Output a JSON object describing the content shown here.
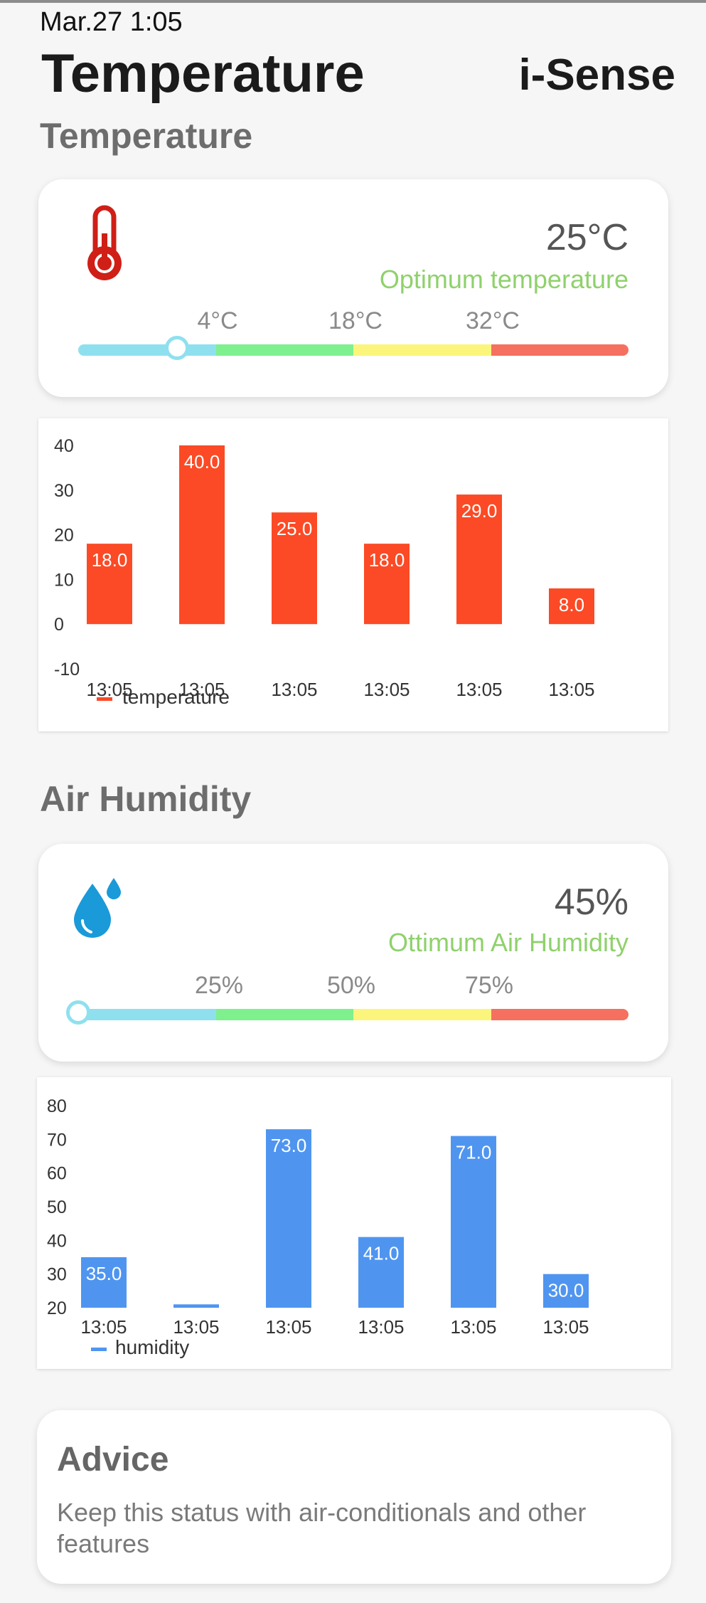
{
  "status_bar": {
    "time": "Mar.27 1:05"
  },
  "header": {
    "title": "Temperature",
    "brand": "i-Sense"
  },
  "temperature": {
    "section_title": "Temperature",
    "icon": "thermometer-icon",
    "value": "25°C",
    "status": "Optimum temperature",
    "scale_labels": [
      "4°C",
      "18°C",
      "32°C"
    ],
    "scale_colors": [
      "#8fe0ef",
      "#7ff08e",
      "#fbf57c",
      "#f5705e"
    ],
    "slider_fraction": 0.18
  },
  "temperature_chart": {
    "chart_data": {
      "type": "bar",
      "categories": [
        "13:05",
        "13:05",
        "13:05",
        "13:05",
        "13:05",
        "13:05"
      ],
      "series": [
        {
          "name": "temperature",
          "values": [
            18.0,
            40.0,
            25.0,
            18.0,
            29.0,
            8.0
          ]
        }
      ],
      "value_labels": [
        "18.0",
        "40.0",
        "25.0",
        "18.0",
        "29.0",
        "8.0"
      ],
      "ylim": [
        -10,
        40
      ],
      "yticks": [
        "40",
        "30",
        "20",
        "10",
        "0",
        "-10"
      ],
      "ytick_values": [
        40,
        30,
        20,
        10,
        0,
        -10
      ],
      "color": "#fb4a25",
      "legend_position": "bottom-left"
    }
  },
  "humidity": {
    "section_title": "Air Humidity",
    "icon": "water-drops-icon",
    "value": "45%",
    "status": "Ottimum Air Humidity",
    "scale_labels": [
      "25%",
      "50%",
      "75%"
    ],
    "scale_colors": [
      "#8fe0ef",
      "#7ff08e",
      "#fbf57c",
      "#f5705e"
    ],
    "slider_fraction": 0.0
  },
  "humidity_chart": {
    "chart_data": {
      "type": "bar",
      "categories": [
        "13:05",
        "13:05",
        "13:05",
        "13:05",
        "13:05",
        "13:05"
      ],
      "series": [
        {
          "name": "humidity",
          "values": [
            35.0,
            21.0,
            73.0,
            41.0,
            71.0,
            30.0
          ]
        }
      ],
      "value_labels": [
        "35.0",
        "",
        "73.0",
        "41.0",
        "71.0",
        "30.0"
      ],
      "ylim": [
        20,
        80
      ],
      "yticks": [
        "80",
        "70",
        "60",
        "50",
        "40",
        "30",
        "20"
      ],
      "ytick_values": [
        80,
        70,
        60,
        50,
        40,
        30,
        20
      ],
      "color": "#4f95f0",
      "legend_position": "bottom-left"
    }
  },
  "advice": {
    "title": "Advice",
    "text": "Keep this status with air-conditionals and other features"
  }
}
